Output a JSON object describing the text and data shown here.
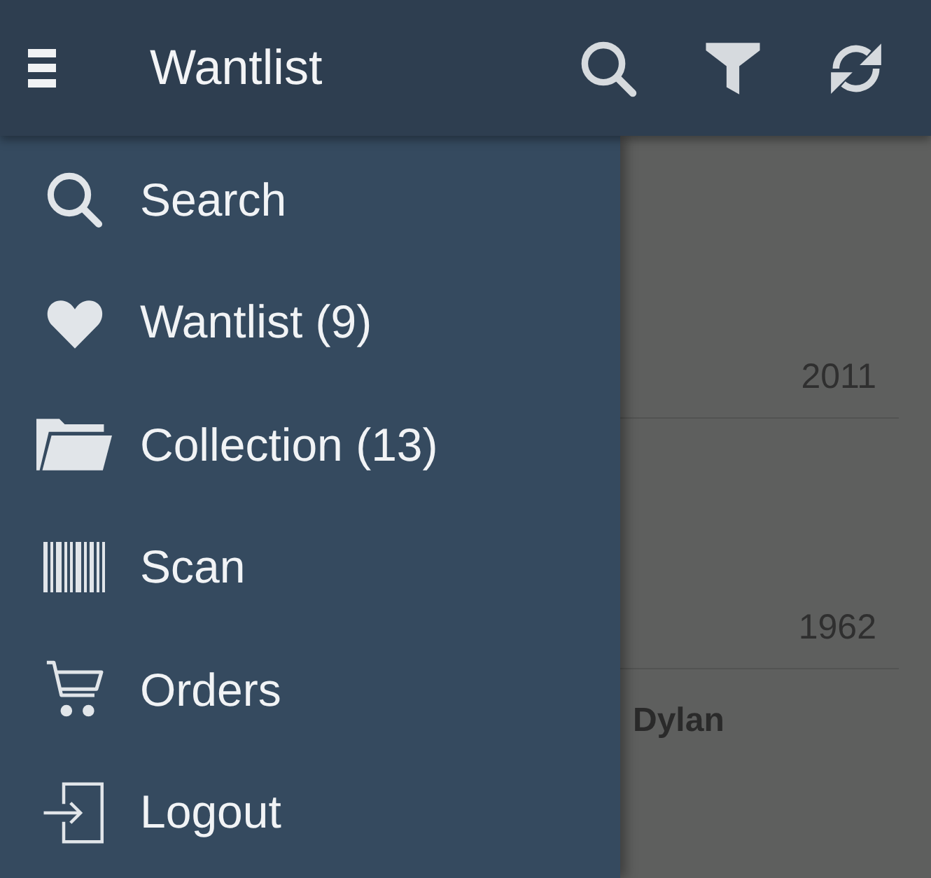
{
  "app_bar": {
    "title": "Wantlist"
  },
  "drawer": {
    "items": [
      {
        "label": "Search"
      },
      {
        "label": "Wantlist (9)"
      },
      {
        "label": "Collection (13)"
      },
      {
        "label": "Scan"
      },
      {
        "label": "Orders"
      },
      {
        "label": "Logout"
      }
    ]
  },
  "list": {
    "rows": [
      {
        "year": "2011"
      },
      {
        "year": "1962"
      },
      {
        "title": "Dylan"
      }
    ]
  }
}
